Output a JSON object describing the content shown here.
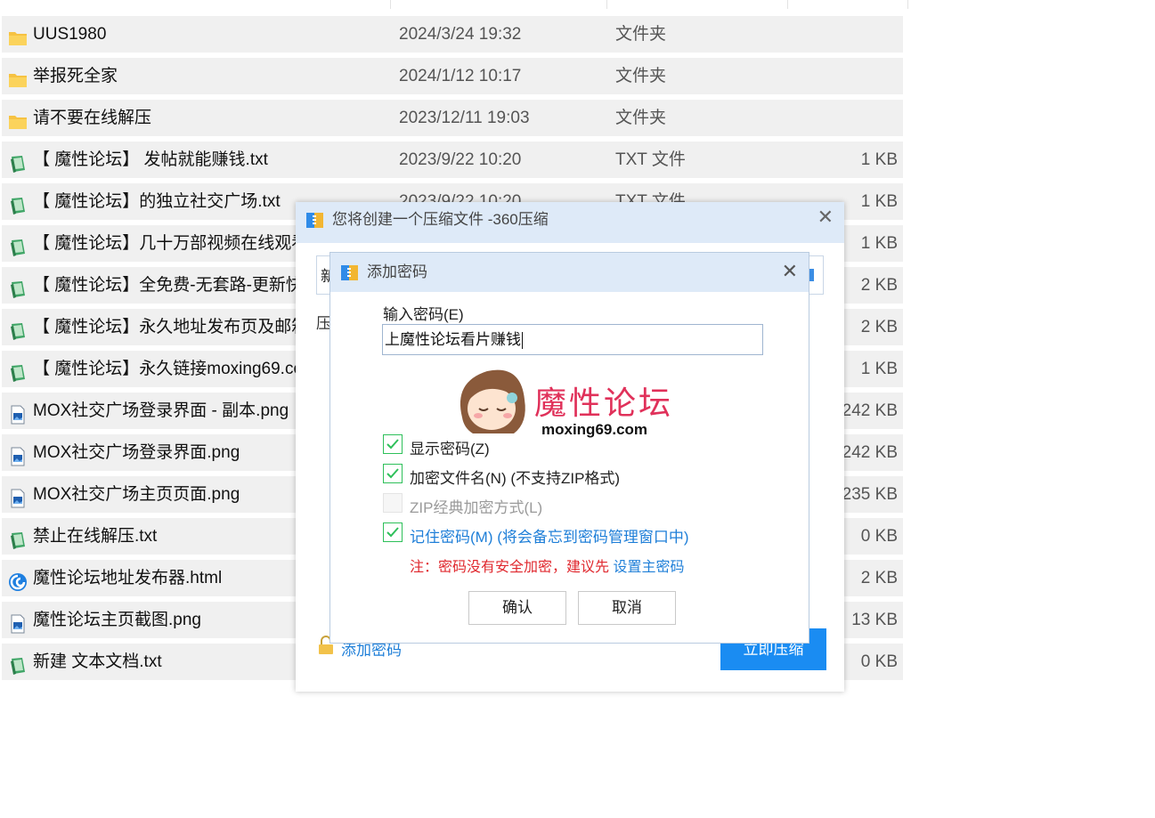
{
  "colors": {
    "accent": "#1a8cf2",
    "check_green": "#2ec05a",
    "warning_red": "#e0282e",
    "row_bg": "#f0f0f0"
  },
  "files": [
    {
      "icon": "folder-icon",
      "name": "UUS1980",
      "date": "2024/3/24 19:32",
      "type": "文件夹",
      "size": ""
    },
    {
      "icon": "folder-icon",
      "name": "举报死全家",
      "date": "2024/1/12 10:17",
      "type": "文件夹",
      "size": ""
    },
    {
      "icon": "folder-icon",
      "name": "请不要在线解压",
      "date": "2023/12/11 19:03",
      "type": "文件夹",
      "size": ""
    },
    {
      "icon": "txt-file-icon",
      "name": "【 魔性论坛】 发帖就能赚钱.txt",
      "date": "2023/9/22 10:20",
      "type": "TXT 文件",
      "size": "1 KB"
    },
    {
      "icon": "txt-file-icon",
      "name": "【 魔性论坛】的独立社交广场.txt",
      "date": "2023/9/22 10:20",
      "type": "TXT 文件",
      "size": "1 KB"
    },
    {
      "icon": "txt-file-icon",
      "name": "【 魔性论坛】几十万部视频在线观看",
      "date": "",
      "type": "",
      "size": "1 KB"
    },
    {
      "icon": "txt-file-icon",
      "name": "【 魔性论坛】全免费-无套路-更新快.",
      "date": "",
      "type": "",
      "size": "2 KB"
    },
    {
      "icon": "txt-file-icon",
      "name": "【 魔性论坛】永久地址发布页及邮箱",
      "date": "",
      "type": "",
      "size": "2 KB"
    },
    {
      "icon": "txt-file-icon",
      "name": "【 魔性论坛】永久链接moxing69.co",
      "date": "",
      "type": "",
      "size": "1 KB"
    },
    {
      "icon": "image-file-icon",
      "name": "MOX社交广场登录界面 - 副本.png",
      "date": "",
      "type": "",
      "size": "242 KB"
    },
    {
      "icon": "image-file-icon",
      "name": "MOX社交广场登录界面.png",
      "date": "",
      "type": "",
      "size": "242 KB"
    },
    {
      "icon": "image-file-icon",
      "name": "MOX社交广场主页页面.png",
      "date": "",
      "type": "",
      "size": "235 KB"
    },
    {
      "icon": "txt-file-icon",
      "name": "禁止在线解压.txt",
      "date": "",
      "type": "",
      "size": "0 KB"
    },
    {
      "icon": "browser-file-icon",
      "name": "魔性论坛地址发布器.html",
      "date": "",
      "type": "",
      "size": "2 KB"
    },
    {
      "icon": "image-file-icon",
      "name": "魔性论坛主页截图.png",
      "date": "",
      "type": "",
      "size": "13 KB"
    },
    {
      "icon": "txt-file-icon",
      "name": "新建 文本文档.txt",
      "date": "",
      "type": "",
      "size": "0 KB"
    }
  ],
  "compress_dialog": {
    "title": "您将创建一个压缩文件 -360压缩",
    "close": "✕",
    "name_stub": "新",
    "format_label_stub": "压",
    "add_password_link": "添加密码",
    "compress_button": "立即压缩"
  },
  "password_dialog": {
    "title": "添加密码",
    "close": "✕",
    "password_label": "输入密码(E)",
    "password_value": "上魔性论坛看片赚钱",
    "watermark_title": "魔性论坛",
    "watermark_url": "moxing69.com",
    "options": [
      {
        "label": "显示密码(Z)",
        "checked": true,
        "disabled": false,
        "style": "normal"
      },
      {
        "label": "加密文件名(N) (不支持ZIP格式)",
        "checked": true,
        "disabled": false,
        "style": "normal"
      },
      {
        "label": "ZIP经典加密方式(L)",
        "checked": false,
        "disabled": true,
        "style": "dis"
      },
      {
        "label": "记住密码(M) (将会备忘到密码管理窗口中)",
        "checked": true,
        "disabled": false,
        "style": "blue"
      }
    ],
    "note_text": "注：密码没有安全加密，建议先 ",
    "note_link": "设置主密码",
    "ok_button": "确认",
    "cancel_button": "取消"
  }
}
